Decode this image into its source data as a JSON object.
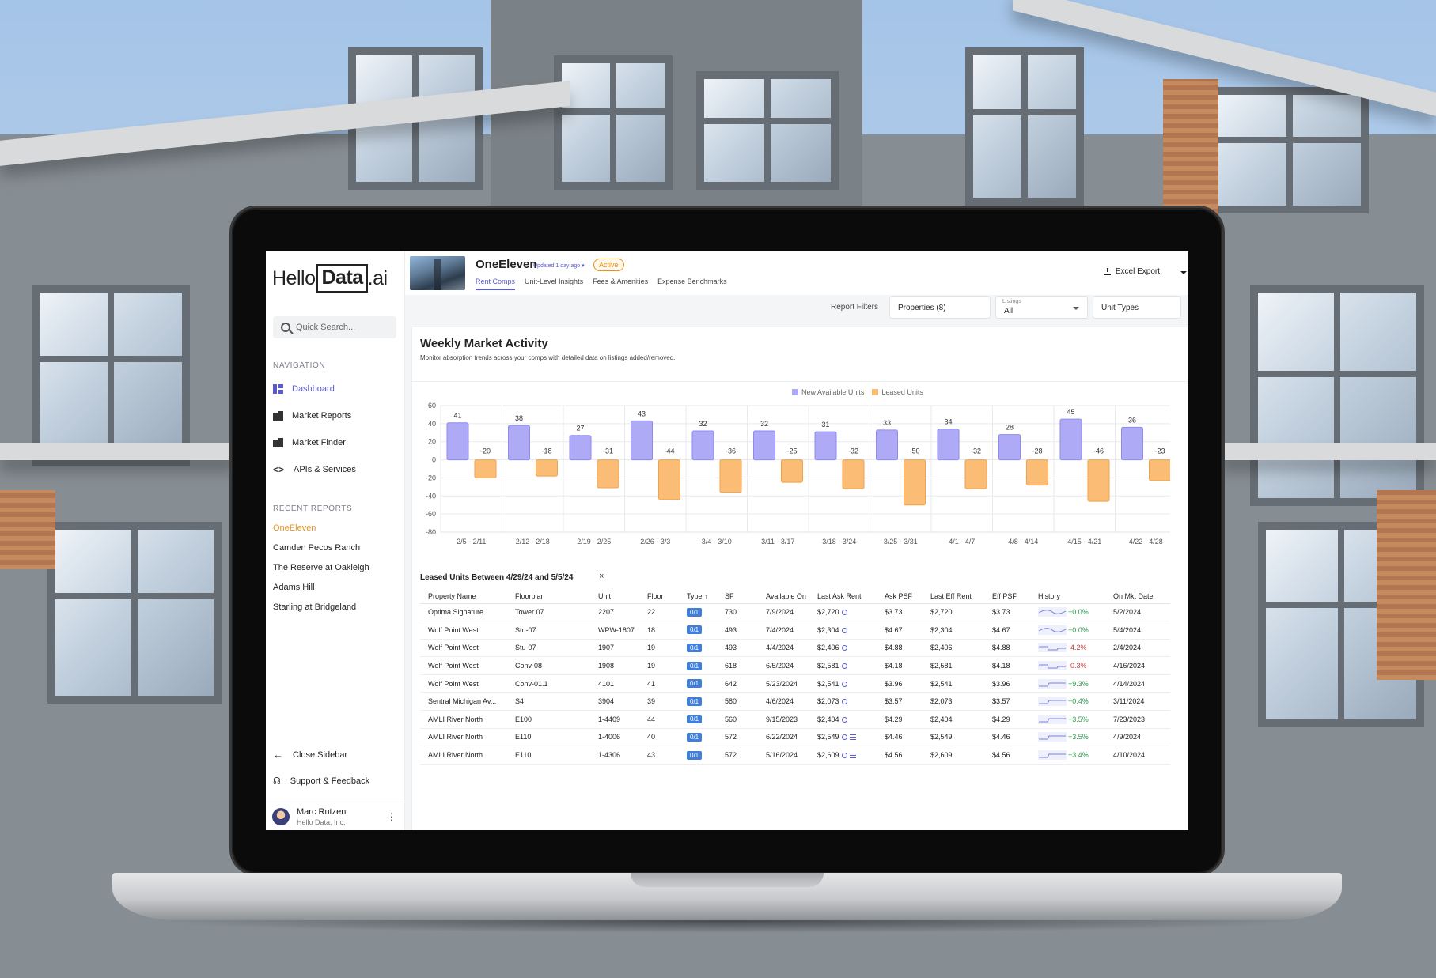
{
  "sidebar": {
    "logo": {
      "hello": "Hello",
      "data": "Data",
      "ai": ".ai"
    },
    "search_placeholder": "Quick Search...",
    "navigation_label": "NAVIGATION",
    "nav_items": [
      {
        "label": "Dashboard",
        "icon": "dashboard-icon",
        "active": true
      },
      {
        "label": "Market Reports",
        "icon": "building-icon"
      },
      {
        "label": "Market Finder",
        "icon": "building-icon"
      },
      {
        "label": "APIs & Services",
        "icon": "code-icon"
      }
    ],
    "recent_reports_label": "RECENT REPORTS",
    "recent_reports": [
      "OneEleven",
      "Camden Pecos Ranch",
      "The Reserve at Oakleigh",
      "Adams Hill",
      "Starling at Bridgeland"
    ],
    "close_sidebar": "Close Sidebar",
    "support": "Support & Feedback",
    "user": {
      "name": "Marc Rutzen",
      "org": "Hello Data, Inc."
    }
  },
  "header": {
    "property_name": "OneEleven",
    "updated": "Updated 1 day ago",
    "status_badge": "Active",
    "tabs": [
      "Rent Comps",
      "Unit-Level Insights",
      "Fees & Amenities",
      "Expense Benchmarks"
    ],
    "active_tab": "Rent Comps",
    "export_label": "Excel Export"
  },
  "filters": {
    "label": "Report Filters",
    "properties": "Properties (8)",
    "listings_label": "Listings",
    "listings_value": "All",
    "unit_types": "Unit Types"
  },
  "activity": {
    "title": "Weekly Market Activity",
    "subtitle": "Monitor absorption trends across your comps with detailed data on listings added/removed."
  },
  "chart_data": {
    "type": "bar",
    "legend": [
      "New Available Units",
      "Leased Units"
    ],
    "colors": {
      "new": "#aeaaf5",
      "leased": "#fbbd75",
      "new_stroke": "#8e8af0",
      "leased_stroke": "#f0a24a"
    },
    "categories": [
      "2/5 - 2/11",
      "2/12 - 2/18",
      "2/19 - 2/25",
      "2/26 - 3/3",
      "3/4 - 3/10",
      "3/11 - 3/17",
      "3/18 - 3/24",
      "3/25 - 3/31",
      "4/1 - 4/7",
      "4/8 - 4/14",
      "4/15 - 4/21",
      "4/22 - 4/28"
    ],
    "series": [
      {
        "name": "New Available Units",
        "values": [
          41,
          38,
          27,
          43,
          32,
          32,
          31,
          33,
          34,
          28,
          45,
          36
        ]
      },
      {
        "name": "Leased Units",
        "values": [
          -20,
          -18,
          -31,
          -44,
          -36,
          -25,
          -32,
          -50,
          -32,
          -28,
          -46,
          -23
        ]
      }
    ],
    "yticks": [
      60,
      40,
      20,
      0,
      -20,
      -40,
      -60,
      -80
    ],
    "ylim": [
      -80,
      60
    ],
    "grid": true,
    "legend_position": "top-center"
  },
  "leased": {
    "title": "Leased Units Between 4/29/24 and 5/5/24",
    "close": "×",
    "columns": [
      "Property Name",
      "Floorplan",
      "Unit",
      "Floor",
      "Type",
      "SF",
      "Available On",
      "Last Ask Rent",
      "Ask PSF",
      "Last Eff Rent",
      "Eff PSF",
      "History",
      "On Mkt Date"
    ],
    "rows": [
      {
        "property": "Optima Signature",
        "floorplan": "Tower 07",
        "unit": "2207",
        "floor": "22",
        "type": "0/1",
        "sf": "730",
        "available": "7/9/2024",
        "ask": "$2,720",
        "ask_psf": "$3.73",
        "eff": "$2,720",
        "eff_psf": "$3.73",
        "history": "+0.0%",
        "trend": "flat",
        "on_mkt": "5/2/2024"
      },
      {
        "property": "Wolf Point West",
        "floorplan": "Stu-07",
        "unit": "WPW-1807",
        "floor": "18",
        "type": "0/1",
        "sf": "493",
        "available": "7/4/2024",
        "ask": "$2,304",
        "ask_psf": "$4.67",
        "eff": "$2,304",
        "eff_psf": "$4.67",
        "history": "+0.0%",
        "trend": "flat",
        "on_mkt": "5/4/2024"
      },
      {
        "property": "Wolf Point West",
        "floorplan": "Stu-07",
        "unit": "1907",
        "floor": "19",
        "type": "0/1",
        "sf": "493",
        "available": "4/4/2024",
        "ask": "$2,406",
        "ask_psf": "$4.88",
        "eff": "$2,406",
        "eff_psf": "$4.88",
        "history": "-4.2%",
        "trend": "down",
        "on_mkt": "2/4/2024"
      },
      {
        "property": "Wolf Point West",
        "floorplan": "Conv-08",
        "unit": "1908",
        "floor": "19",
        "type": "0/1",
        "sf": "618",
        "available": "6/5/2024",
        "ask": "$2,581",
        "ask_psf": "$4.18",
        "eff": "$2,581",
        "eff_psf": "$4.18",
        "history": "-0.3%",
        "trend": "down",
        "on_mkt": "4/16/2024"
      },
      {
        "property": "Wolf Point West",
        "floorplan": "Conv-01.1",
        "unit": "4101",
        "floor": "41",
        "type": "0/1",
        "sf": "642",
        "available": "5/23/2024",
        "ask": "$2,541",
        "ask_psf": "$3.96",
        "eff": "$2,541",
        "eff_psf": "$3.96",
        "history": "+9.3%",
        "trend": "up",
        "on_mkt": "4/14/2024"
      },
      {
        "property": "Sentral Michigan Av...",
        "floorplan": "S4",
        "unit": "3904",
        "floor": "39",
        "type": "0/1",
        "sf": "580",
        "available": "4/6/2024",
        "ask": "$2,073",
        "ask_psf": "$3.57",
        "eff": "$2,073",
        "eff_psf": "$3.57",
        "history": "+0.4%",
        "trend": "up",
        "on_mkt": "3/11/2024"
      },
      {
        "property": "AMLI River North",
        "floorplan": "E100",
        "unit": "1-4409",
        "floor": "44",
        "type": "0/1",
        "sf": "560",
        "available": "9/15/2023",
        "ask": "$2,404",
        "ask_psf": "$4.29",
        "eff": "$2,404",
        "eff_psf": "$4.29",
        "history": "+3.5%",
        "trend": "up",
        "on_mkt": "7/23/2023"
      },
      {
        "property": "AMLI River North",
        "floorplan": "E110",
        "unit": "1-4006",
        "floor": "40",
        "type": "0/1",
        "sf": "572",
        "available": "6/22/2024",
        "ask": "$2,549",
        "ask_psf": "$4.46",
        "eff": "$2,549",
        "eff_psf": "$4.46",
        "history": "+3.5%",
        "trend": "up",
        "on_mkt": "4/9/2024"
      },
      {
        "property": "AMLI River North",
        "floorplan": "E110",
        "unit": "1-4306",
        "floor": "43",
        "type": "0/1",
        "sf": "572",
        "available": "5/16/2024",
        "ask": "$2,609",
        "ask_psf": "$4.56",
        "eff": "$2,609",
        "eff_psf": "$4.56",
        "history": "+3.4%",
        "trend": "up",
        "on_mkt": "4/10/2024"
      }
    ]
  }
}
